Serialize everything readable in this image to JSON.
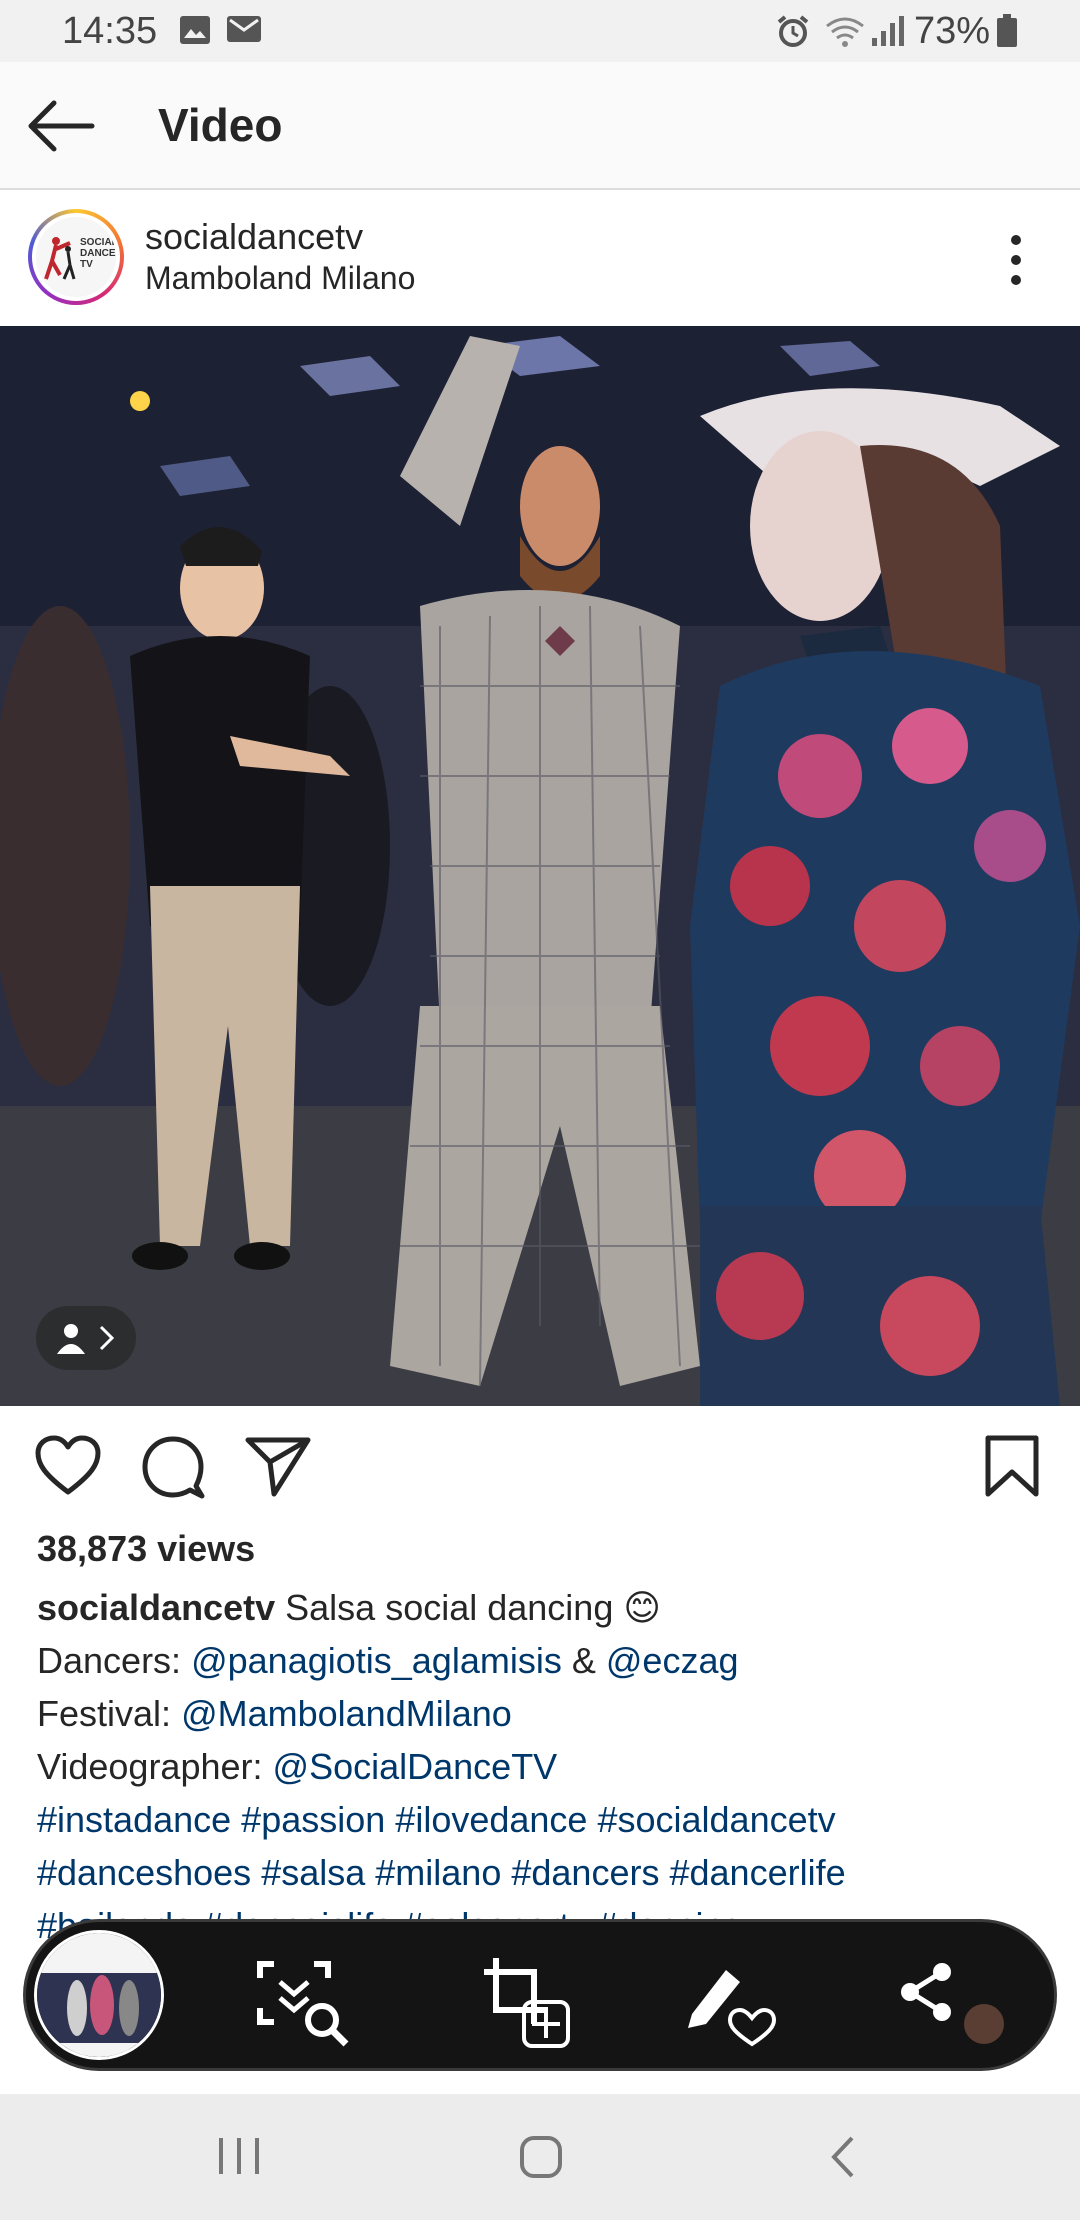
{
  "status_bar": {
    "time": "14:35",
    "battery_percent": "73%",
    "icons": [
      "image-icon",
      "mail-icon",
      "alarm-icon",
      "wifi-icon",
      "signal-icon",
      "battery-icon"
    ]
  },
  "app_bar": {
    "title": "Video"
  },
  "post": {
    "username": "socialdancetv",
    "location": "Mamboland Milano",
    "avatar_text": [
      "SOCIAL",
      "DANCE",
      "TV"
    ]
  },
  "stats": {
    "views": "38,873 views"
  },
  "caption": {
    "author": "socialdancetv",
    "text": "Salsa social dancing",
    "emoji": "😊",
    "dancers_label": "Dancers:",
    "dancer_1": "@panagiotis_aglamisis",
    "amp": "&",
    "dancer_2": "@eczag",
    "festival_label": "Festival:",
    "festival": "@MambolandMilano",
    "videographer_label": "Videographer:",
    "videographer": "@SocialDanceTV",
    "hashtags_line1": [
      "#instadance",
      "#passion",
      "#ilovedance",
      "#socialdancetv"
    ],
    "hashtags_line2": [
      "#danceshoes",
      "#salsa",
      "#milano",
      "#dancers",
      "#dancerlife"
    ],
    "hashtags_line3": [
      "#bailando",
      "#danceislife",
      "#salsaparty",
      "#dancing"
    ]
  },
  "colors": {
    "link": "#00376b",
    "text": "#262626",
    "toolbar_bg": "#141414"
  }
}
